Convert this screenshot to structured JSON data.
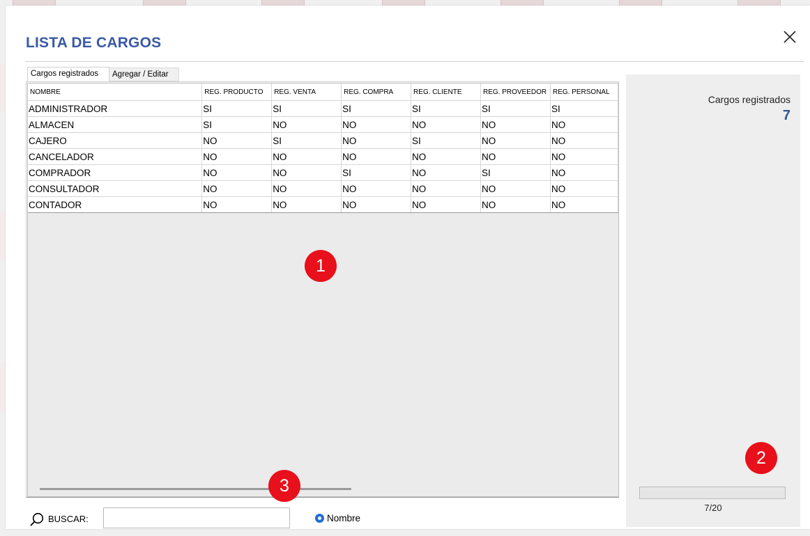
{
  "dialog": {
    "title": "LISTA DE CARGOS",
    "close_icon": "close-icon"
  },
  "tabs": [
    {
      "label": "Cargos registrados",
      "active": true
    },
    {
      "label": "Agregar / Editar",
      "active": false
    }
  ],
  "grid": {
    "columns": [
      "NOMBRE",
      "REG. PRODUCTO",
      "REG. VENTA",
      "REG. COMPRA",
      "REG. CLIENTE",
      "REG. PROVEEDOR",
      "REG. PERSONAL"
    ],
    "rows": [
      [
        "ADMINISTRADOR",
        "SI",
        "SI",
        "SI",
        "SI",
        "SI",
        "SI"
      ],
      [
        "ALMACEN",
        "SI",
        "NO",
        "NO",
        "NO",
        "NO",
        "NO"
      ],
      [
        "CAJERO",
        "NO",
        "SI",
        "NO",
        "SI",
        "NO",
        "NO"
      ],
      [
        "CANCELADOR",
        "NO",
        "NO",
        "NO",
        "NO",
        "NO",
        "NO"
      ],
      [
        "COMPRADOR",
        "NO",
        "NO",
        "SI",
        "NO",
        "SI",
        "NO"
      ],
      [
        "CONSULTADOR",
        "NO",
        "NO",
        "NO",
        "NO",
        "NO",
        "NO"
      ],
      [
        "CONTADOR",
        "NO",
        "NO",
        "NO",
        "NO",
        "NO",
        "NO"
      ]
    ]
  },
  "side": {
    "label": "Cargos registrados",
    "count": "7",
    "progress_text": "7/20",
    "progress_fraction": 0.0
  },
  "search": {
    "label": "BUSCAR:",
    "value": "",
    "icon": "search-icon",
    "radio_label": "Nombre"
  },
  "markers": [
    "1",
    "2",
    "3"
  ],
  "colors": {
    "title": "#3a5aa6",
    "count": "#2f5597",
    "marker": "#e8101a",
    "radio": "#1f6fd1"
  }
}
